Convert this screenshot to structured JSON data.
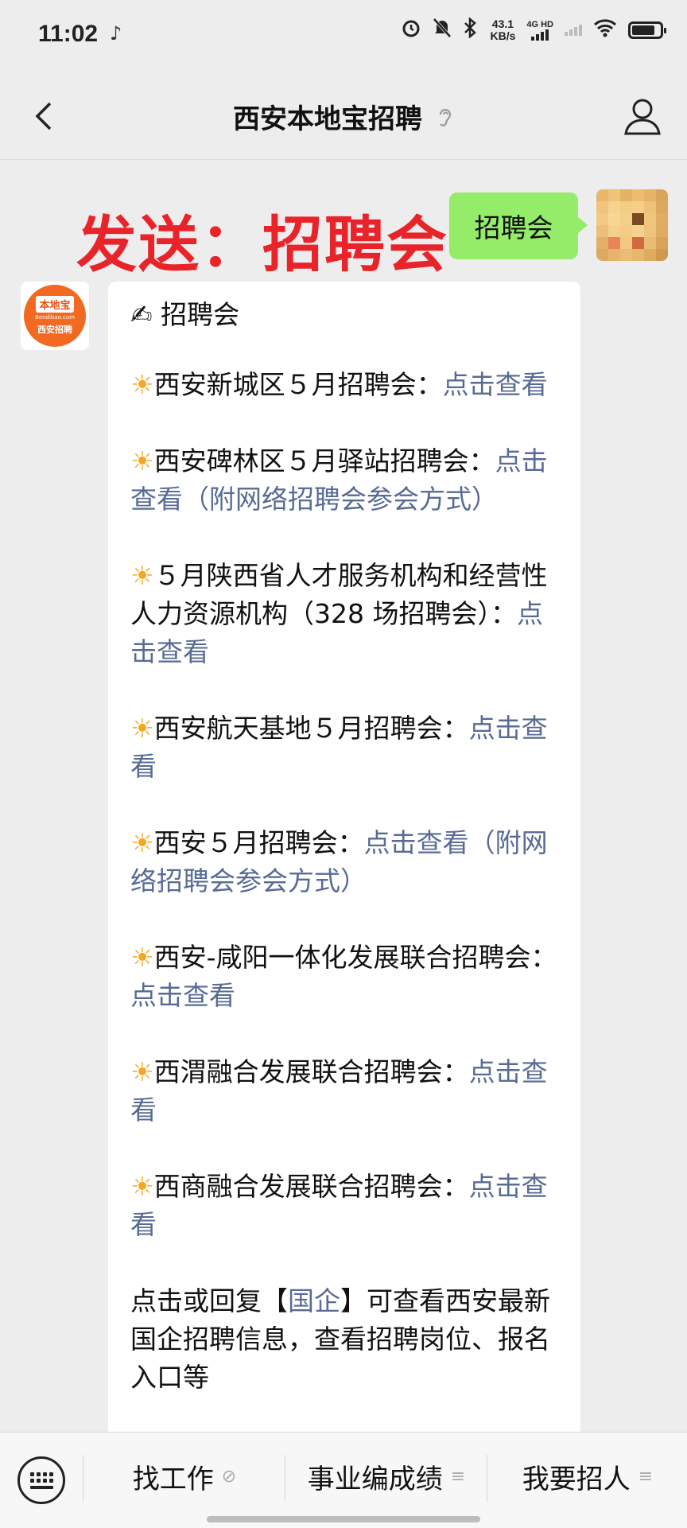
{
  "status_bar": {
    "time": "11:02",
    "net_speed_value": "43.1",
    "net_speed_unit": "KB/s",
    "network_label": "4G HD",
    "icons": [
      "music-note-icon",
      "alarm-icon",
      "mute-icon",
      "bluetooth-icon",
      "signal-icon",
      "wifi-icon",
      "battery-icon"
    ]
  },
  "header": {
    "title": "西安本地宝招聘"
  },
  "chat": {
    "annotation": "发送：招聘会",
    "sent_message": "招聘会",
    "sender_logo": {
      "brand": "本地宝",
      "domain": "Bendibao.com",
      "sub": "西安招聘"
    },
    "reply": {
      "heading_emoji": "✍",
      "heading": "招聘会",
      "items": [
        {
          "text": "西安新城区５月招聘会：",
          "link": "点击查看"
        },
        {
          "text": "西安碑林区５月驿站招聘会：",
          "link": "点击查看（附网络招聘会参会方式）"
        },
        {
          "text": "５月陕西省人才服务机构和经营性人力资源机构（328 场招聘会）：",
          "link": "点击查看"
        },
        {
          "text": "西安航天基地５月招聘会：",
          "link": "点击查看"
        },
        {
          "text": "西安５月招聘会：",
          "link": "点击查看（附网络招聘会参会方式）"
        },
        {
          "text": "西安-咸阳一体化发展联合招聘会：",
          "link": "点击查看"
        },
        {
          "text": "西渭融合发展联合招聘会：",
          "link": "点击查看"
        },
        {
          "text": "西商融合发展联合招聘会：",
          "link": "点击查看"
        }
      ],
      "footer_prefix": "点击或回复【",
      "footer_link": "国企",
      "footer_suffix": "】可查看西安最新国企招聘信息，查看招聘岗位、报名入口等"
    }
  },
  "bottom_menu": {
    "items": [
      {
        "label": "找工作",
        "icon": "link-icon"
      },
      {
        "label": "事业编成绩",
        "icon": "menu-icon"
      },
      {
        "label": "我要招人",
        "icon": "menu-icon"
      }
    ]
  }
}
